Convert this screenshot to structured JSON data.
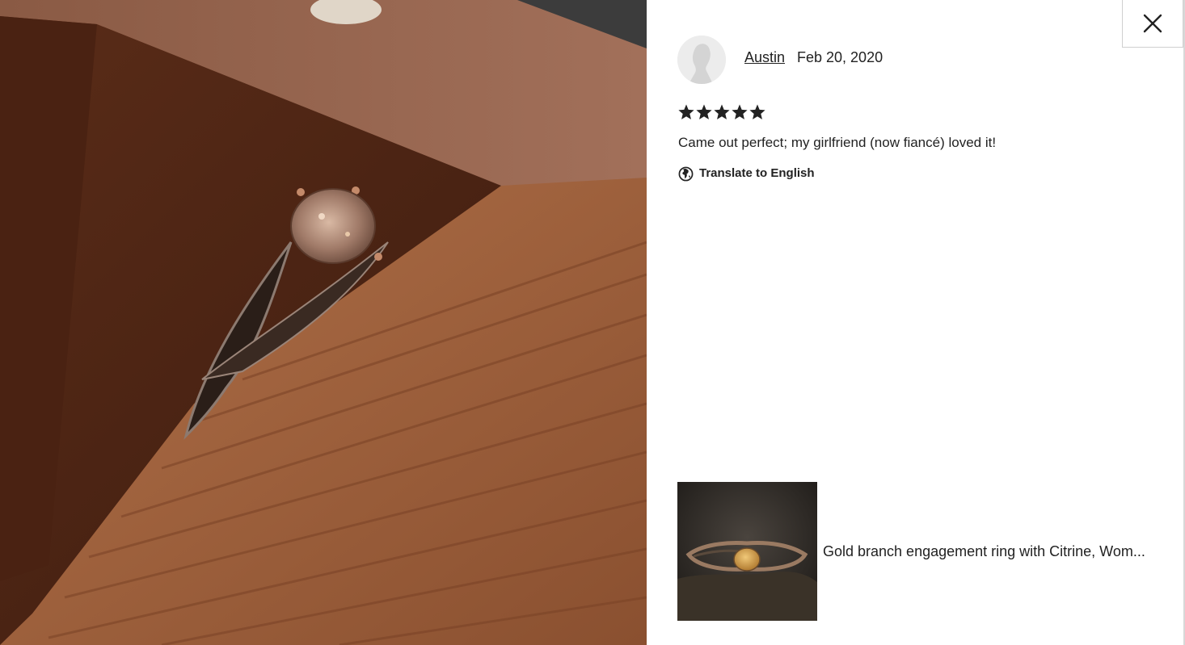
{
  "review": {
    "reviewer_name": "Austin",
    "date": "Feb 20, 2020",
    "rating": 5,
    "max_rating": 5,
    "text": "Came out perfect; my girlfriend (now fiancé) loved it!",
    "translate_label": "Translate to English"
  },
  "product": {
    "title": "Gold branch engagement ring with Citrine, Wom..."
  },
  "icons": {
    "close": "close-icon",
    "globe": "globe-icon",
    "star": "star-icon",
    "avatar": "default-avatar-icon"
  },
  "colors": {
    "text": "#222222",
    "star": "#222222",
    "divider": "#cfcfcf"
  }
}
